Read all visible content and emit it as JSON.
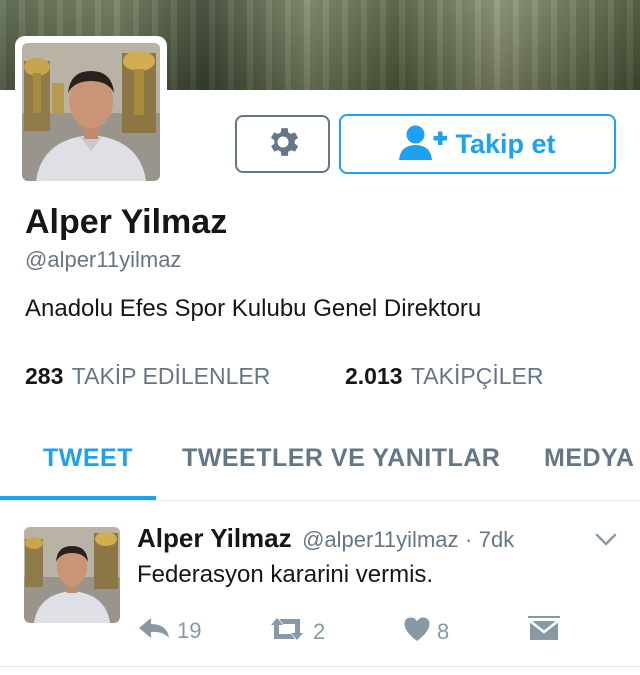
{
  "profile": {
    "name": "Alper Yilmaz",
    "handle": "@alper11yilmaz",
    "bio": "Anadolu Efes Spor Kulubu Genel Direktoru",
    "following_count": "283",
    "following_label": "TAKİP EDİLENLER",
    "followers_count": "2.013",
    "followers_label": "TAKİPÇİLER"
  },
  "buttons": {
    "settings_icon": "gear-icon",
    "follow_label": "Takip et",
    "follow_icon": "add-person-icon"
  },
  "tabs": [
    {
      "label": "TWEET",
      "active": true
    },
    {
      "label": "TWEETLER VE YANITLAR",
      "active": false
    },
    {
      "label": "MEDYA",
      "active": false
    }
  ],
  "tweet": {
    "author_name": "Alper Yilmaz",
    "author_handle": "@alper11yilmaz",
    "separator": "·",
    "time": "7dk",
    "text": "Federasyon kararini vermis.",
    "reply_count": "19",
    "retweet_count": "2",
    "like_count": "8"
  },
  "colors": {
    "accent": "#1da1f2",
    "muted": "#657786",
    "action": "#8899a6",
    "border": "#e1e8ed"
  }
}
